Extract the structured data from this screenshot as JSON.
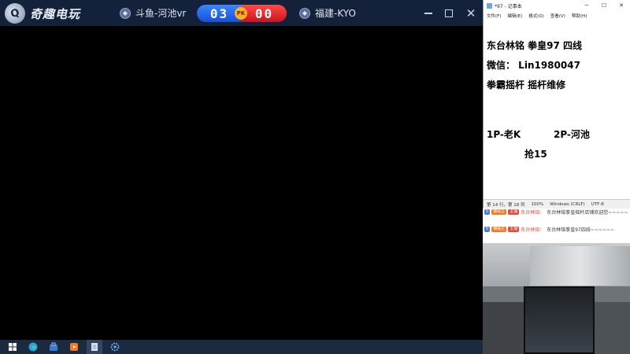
{
  "game": {
    "logo_text": "奇趣电玩",
    "player1": "斗鱼-河池vr",
    "player2": "福建-KYO",
    "score1": "03",
    "score2": "00",
    "pk_label": "PK",
    "colors": {
      "titlebar": "#14213a",
      "score_blue": "#1f5fe6",
      "score_red": "#d41c26"
    }
  },
  "notepad": {
    "title": "*97 - 记事本",
    "menu": [
      "文件(F)",
      "编辑(E)",
      "格式(O)",
      "查看(V)",
      "帮助(H)"
    ],
    "lines": [
      "东台林铭 拳皇97 四线",
      "微信： Lin1980047",
      "拳霸摇杆  摇杆维修",
      "",
      "1P-老K          2P-河池",
      "抢15"
    ],
    "status": [
      "第 14 行，第 18 列",
      "100%",
      "Windows (CRLF)",
      "UTF-8"
    ]
  },
  "chat": {
    "messages": [
      {
        "level": "5",
        "fan": "御殿主",
        "tag": "主播",
        "name": "东台林铭：",
        "text": "东台林铭拳皇摇杆店铺欢迎您~~~~~"
      },
      {
        "level": "5",
        "fan": "御殿主",
        "tag": "主播",
        "name": "东台林铭：",
        "text": "东台林铭拳皇97四线~~~~~~"
      }
    ]
  },
  "taskbar": {
    "icons": [
      "windows-start-icon",
      "edge-browser-icon",
      "store-icon",
      "media-player-icon",
      "notepad-icon",
      "settings-icon"
    ]
  }
}
